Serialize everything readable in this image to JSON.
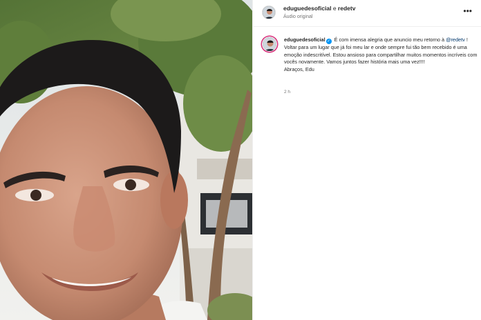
{
  "header": {
    "author": "eduguedesoficial",
    "connector": "e",
    "coauthor": "redetv",
    "audio": "Áudio original",
    "more_icon": "more-horizontal-icon"
  },
  "caption": {
    "username": "eduguedesoficial",
    "verified_icon": "verified-badge-icon",
    "text_before_mention": "É com imensa alegria que anuncio meu retorno à",
    "mention": "@redetv",
    "text_after_mention": "! Voltar para um lugar que já foi meu lar e onde sempre fui tão bem recebido é uma emoção indescritível. Estou ansioso para compartilhar muitos momentos incríveis com vocês novamente. Vamos juntos fazer história mais uma vez!!!!",
    "signature": "Abraços, Edu",
    "time": "2 h"
  },
  "colors": {
    "mention": "#00376b",
    "verified": "#0095f6",
    "secondary_text": "#737373",
    "story_ring": "#d62976"
  }
}
